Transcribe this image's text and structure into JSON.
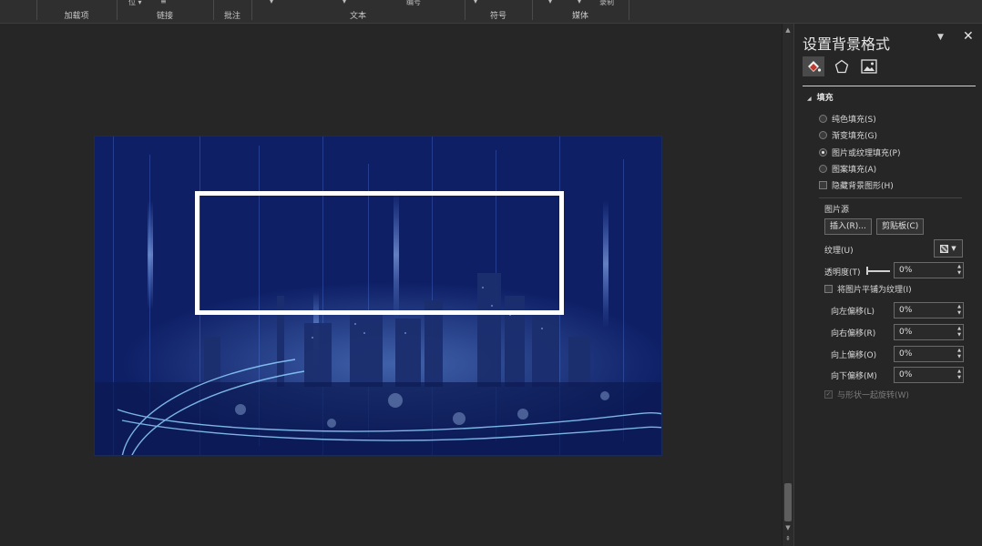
{
  "ribbon": {
    "groups": [
      {
        "title": "加载项",
        "top": ""
      },
      {
        "title": "链接",
        "top": "位 ▾"
      },
      {
        "title": "批注",
        "top": ""
      },
      {
        "title": "文本",
        "top": "编号"
      },
      {
        "title": "符号",
        "top": ""
      },
      {
        "title": "媒体",
        "top": "录制"
      }
    ]
  },
  "pane": {
    "title": "设置背景格式",
    "dropdown_icon": "▼",
    "close_label": "✕",
    "tabs": [
      "fill-icon",
      "pentagon-icon",
      "picture-icon"
    ],
    "section": "填充",
    "fill_options": [
      {
        "label": "纯色填充(S)",
        "selected": false
      },
      {
        "label": "渐变填充(G)",
        "selected": false
      },
      {
        "label": "图片或纹理填充(P)",
        "selected": true
      },
      {
        "label": "图案填充(A)",
        "selected": false
      }
    ],
    "hide_bg_label": "隐藏背景图形(H)",
    "picture_source_label": "图片源",
    "insert_button": "插入(R)...",
    "clipboard_button": "剪贴板(C)",
    "texture_label": "纹理(U)",
    "transparency_label": "透明度(T)",
    "transparency_value": "0%",
    "tile_label": "将图片平铺为纹理(I)",
    "offsets": [
      {
        "label": "向左偏移(L)",
        "value": "0%"
      },
      {
        "label": "向右偏移(R)",
        "value": "0%"
      },
      {
        "label": "向上偏移(O)",
        "value": "0%"
      },
      {
        "label": "向下偏移(M)",
        "value": "0%"
      }
    ],
    "rotate_label": "与形状一起旋转(W)"
  },
  "colors": {
    "accent": "#c0392b",
    "slide_bg": "#132a78",
    "frame": "#ffffff"
  }
}
